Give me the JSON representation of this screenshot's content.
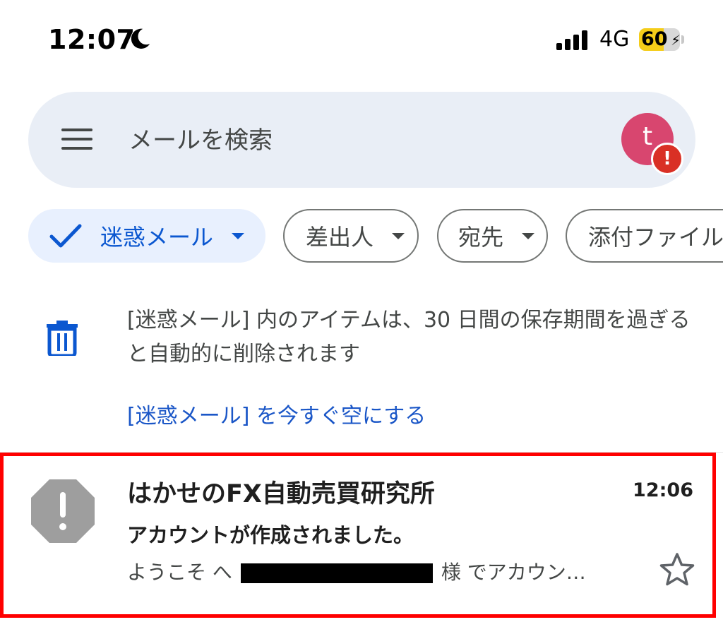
{
  "status_bar": {
    "time": "12:07",
    "network": "4G",
    "battery": "60",
    "battery_level": 0.6,
    "icons": [
      "moon-icon",
      "signal-icon",
      "battery-charging-icon"
    ]
  },
  "search": {
    "placeholder": "メールを検索",
    "avatar_letter": "t",
    "avatar_color": "#d8466f",
    "alert_symbol": "!"
  },
  "filters": [
    {
      "label": "迷惑メール",
      "selected": true
    },
    {
      "label": "差出人",
      "selected": false
    },
    {
      "label": "宛先",
      "selected": false
    },
    {
      "label": "添付ファイル",
      "selected": false
    }
  ],
  "notice": {
    "text": "[迷惑メール] 内のアイテムは、30 日間の保存期間を過ぎると自動的に削除されます",
    "action": "[迷惑メール] を今すぐ空にする"
  },
  "emails": [
    {
      "sender": "はかせのFX自動売買研究所",
      "time": "12:06",
      "subject": "アカウントが作成されました。",
      "snippet_start": "ようこそ へ",
      "snippet_end": "様 でアカウン…",
      "starred": false
    }
  ],
  "colors": {
    "accent": "#0b57d0",
    "link": "#1a56c7",
    "search_bg": "#e9eef6",
    "highlight": "#ff0000",
    "battery_yellow": "#f5cd19"
  }
}
